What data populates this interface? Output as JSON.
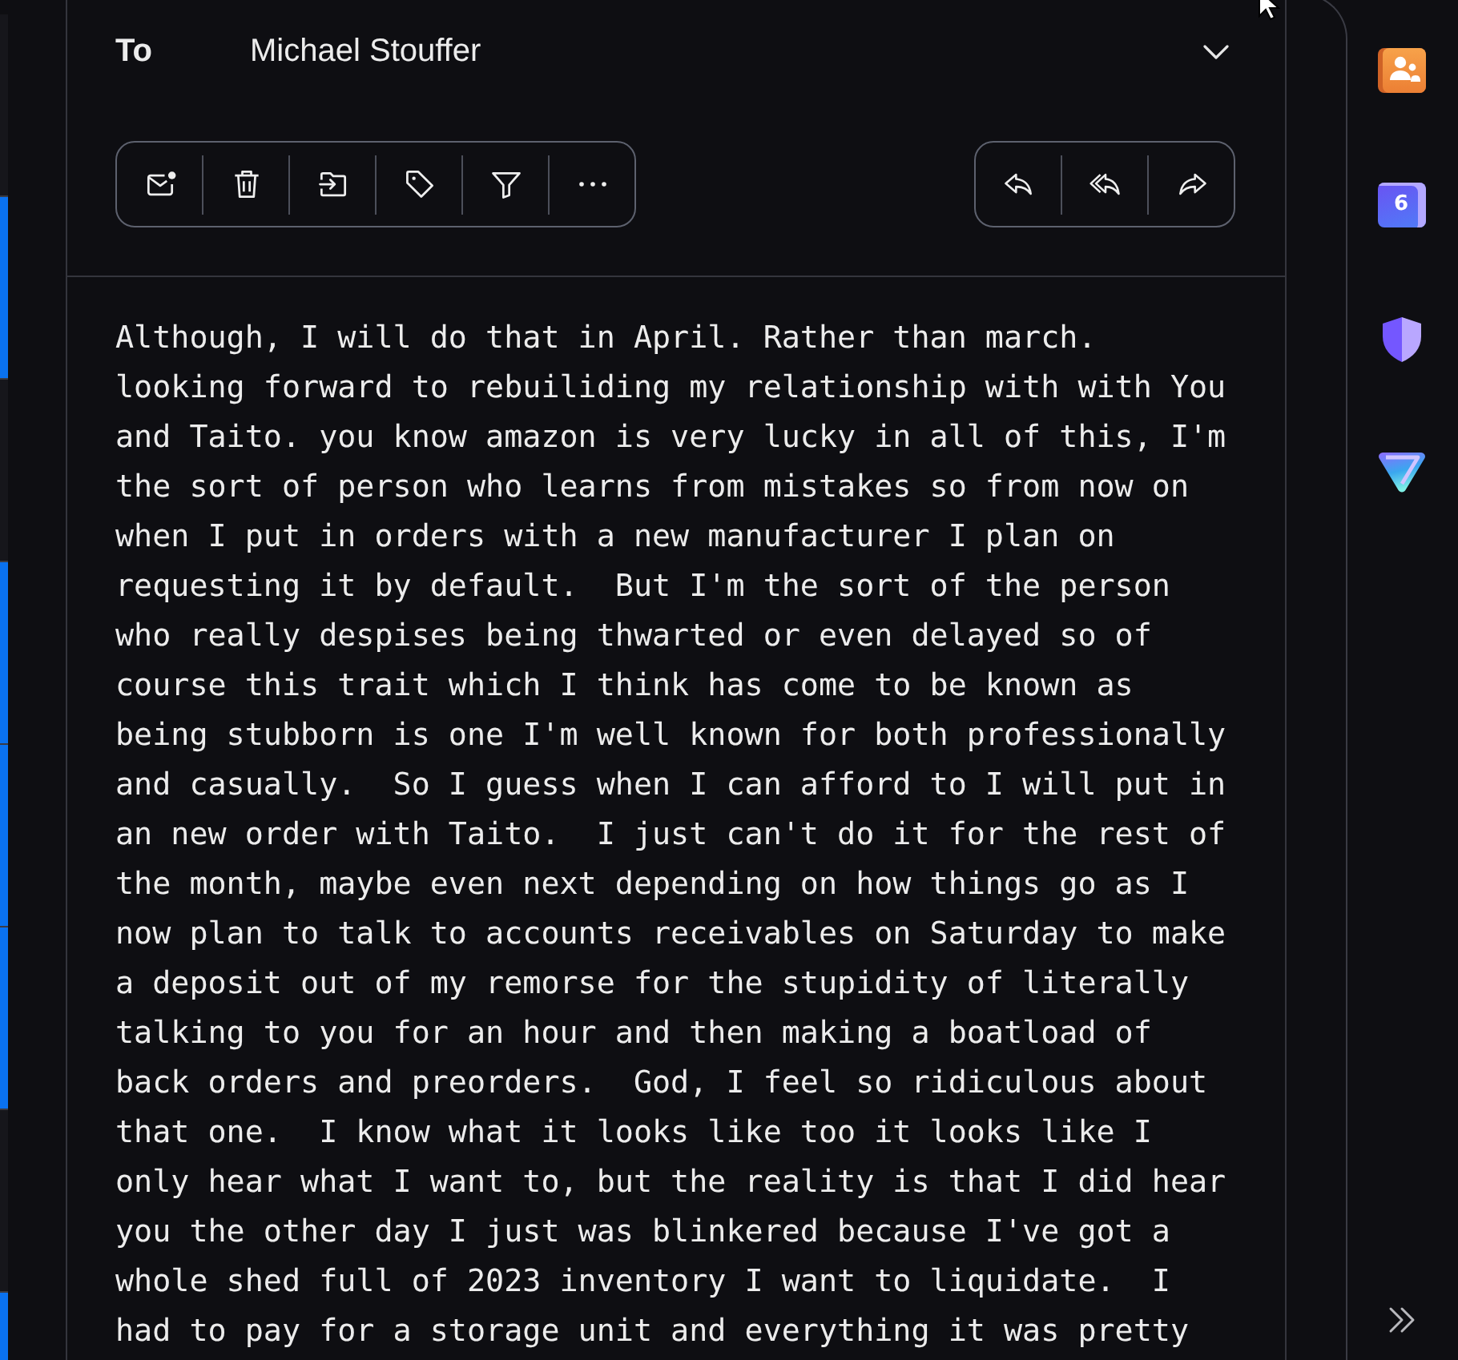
{
  "message_list": [
    {
      "highlighted": false
    },
    {
      "highlighted": true
    },
    {
      "highlighted": false
    },
    {
      "highlighted": true
    },
    {
      "highlighted": true
    },
    {
      "highlighted": true
    },
    {
      "highlighted": false
    },
    {
      "highlighted": true
    }
  ],
  "header": {
    "to_label": "To",
    "recipient": "Michael Stouffer"
  },
  "body": {
    "text": "Although, I will do that in April. Rather than march. looking forward to rebuiliding my relationship with with You and Taito. you know amazon is very lucky in all of this, I'm the sort of person who learns from mistakes so from now on when I put in orders with a new manufacturer I plan on requesting it by default.  But I'm the sort of the person who really despises being thwarted or even delayed so of course this trait which I think has come to be known as being stubborn is one I'm well known for both professionally and casually.  So I guess when I can afford to I will put in an new order with Taito.  I just can't do it for the rest of the month, maybe even next depending on how things go as I now plan to talk to accounts receivables on Saturday to make a deposit out of my remorse for the stupidity of literally talking to you for an hour and then making a boatload of back orders and preorders.  God, I feel so ridiculous about that one.  I know what it looks like too it looks like I only hear what I want to, but the reality is that I did hear you the other day I just was blinkered because I've got a whole shed full of 2023 inventory I want to liquidate.  I had to pay for a storage unit and everything it was pretty"
  },
  "sidebar": {
    "calendar_tile_number": "6"
  }
}
